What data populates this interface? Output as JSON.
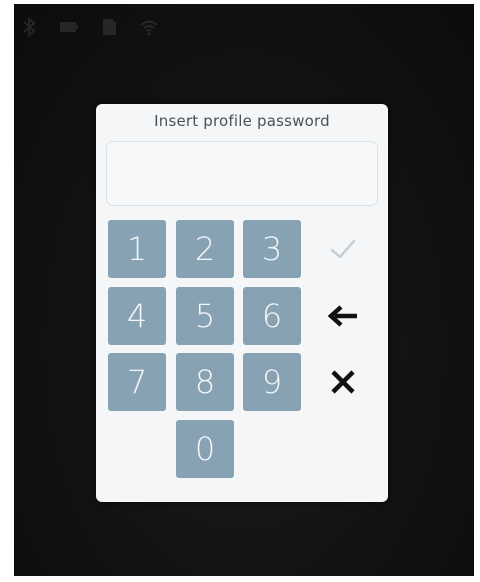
{
  "dialog": {
    "title": "Insert profile password",
    "password_value": ""
  },
  "keypad": {
    "digits": [
      "1",
      "2",
      "3",
      "4",
      "5",
      "6",
      "7",
      "8",
      "9",
      "0"
    ]
  },
  "actions": {
    "confirm_icon": "checkmark-icon",
    "backspace_icon": "arrow-left-icon",
    "cancel_icon": "close-icon"
  },
  "status_icons": [
    "bluetooth-icon",
    "battery-icon",
    "sd-card-icon",
    "wifi-icon"
  ],
  "colors": {
    "key_background": "#86a2b3",
    "key_text": "#f4f6f7",
    "dialog_background": "#f4f6f7",
    "confirm_disabled": "#c9cfd2",
    "action_dark": "#111111",
    "screen_background": "#111111"
  }
}
